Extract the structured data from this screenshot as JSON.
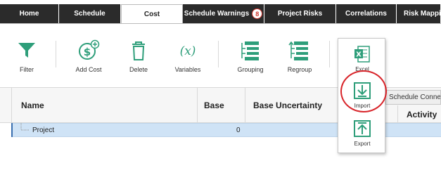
{
  "tabs": [
    {
      "label": "Home"
    },
    {
      "label": "Schedule"
    },
    {
      "label": "Cost",
      "active": true
    },
    {
      "label": "Schedule Warnings",
      "badge": "8"
    },
    {
      "label": "Project Risks"
    },
    {
      "label": "Correlations"
    },
    {
      "label": "Risk Mapping"
    }
  ],
  "toolbar": {
    "filter": "Filter",
    "add_cost": "Add Cost",
    "delete": "Delete",
    "variables": "Variables",
    "grouping": "Grouping",
    "regroup": "Regroup"
  },
  "popup": {
    "excel": "Excel",
    "import": "Import",
    "export": "Export"
  },
  "schedule_connect": "Schedule Connect",
  "grid": {
    "headers": {
      "name": "Name",
      "base": "Base",
      "base_uncertainty": "Base Uncertainty",
      "activity": "Activity"
    },
    "rows": [
      {
        "name": "Project",
        "base": "0"
      }
    ]
  },
  "colors": {
    "accent": "#2e9e7a",
    "tab_dark": "#2b2b2b",
    "badge": "#d0342c",
    "highlight_circle": "#d8242a",
    "selected_row": "#cfe3f6"
  }
}
